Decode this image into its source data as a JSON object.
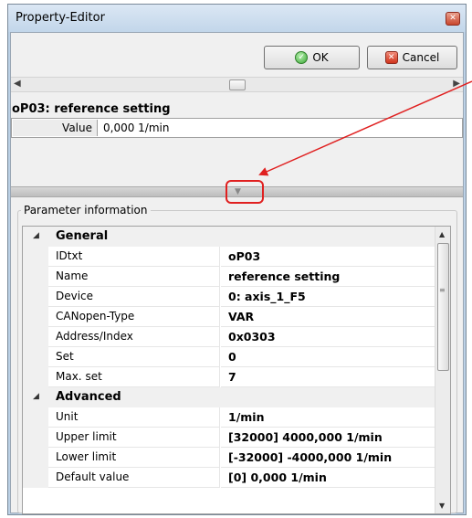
{
  "window": {
    "title": "Property-Editor",
    "close_symbol": "✕"
  },
  "toolbar": {
    "ok_label": "OK",
    "cancel_label": "Cancel"
  },
  "parameter": {
    "header": "oP03: reference setting",
    "value_label": "Value",
    "value": "0,000 1/min"
  },
  "info": {
    "title": "Parameter information",
    "groups": [
      {
        "label": "General",
        "rows": [
          {
            "name": "IDtxt",
            "value": "oP03"
          },
          {
            "name": "Name",
            "value": "reference setting"
          },
          {
            "name": "Device",
            "value": "0: axis_1_F5"
          },
          {
            "name": "CANopen-Type",
            "value": "VAR"
          },
          {
            "name": "Address/Index",
            "value": "0x0303"
          },
          {
            "name": "Set",
            "value": "0"
          },
          {
            "name": "Max. set",
            "value": "7"
          }
        ]
      },
      {
        "label": "Advanced",
        "rows": [
          {
            "name": "Unit",
            "value": " 1/min"
          },
          {
            "name": "Upper limit",
            "value": "[32000] 4000,000 1/min"
          },
          {
            "name": "Lower limit",
            "value": "[-32000] -4000,000 1/min"
          },
          {
            "name": "Default value",
            "value": "[0] 0,000 1/min"
          }
        ]
      }
    ]
  },
  "icons": {
    "ok": "check-circle-icon",
    "cancel": "x-square-icon",
    "expand": "triangle-down-icon",
    "annotation_color": "#e02020"
  }
}
